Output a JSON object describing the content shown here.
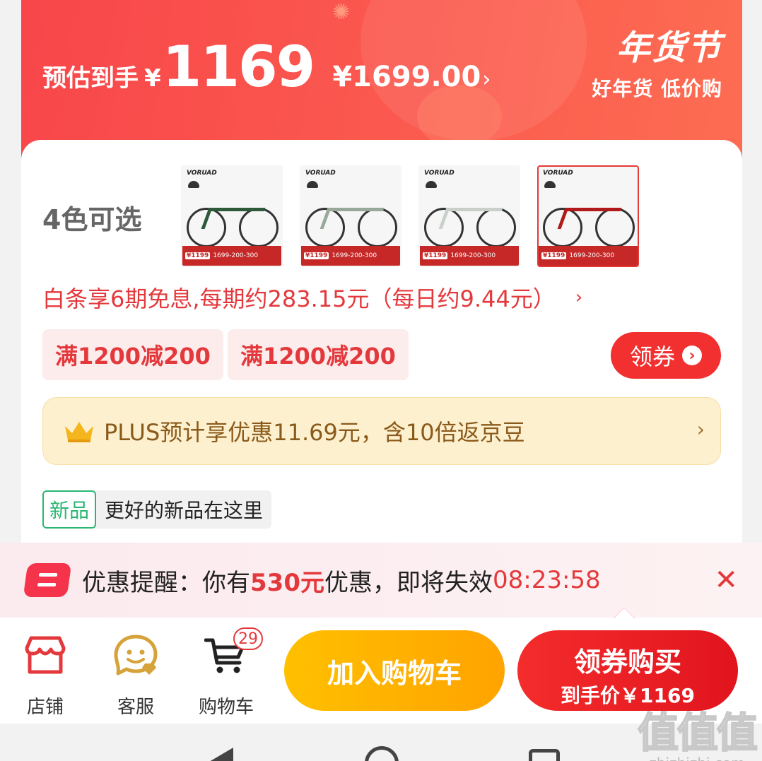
{
  "banner": {
    "estimate_label": "预估到手",
    "yen": "¥",
    "price": "1169",
    "original_price": "¥1699.00",
    "chevron": "›",
    "festival_title": "年货节",
    "festival_sub": "好年货 低价购"
  },
  "product": {
    "color_label": "4色可选",
    "variants": [
      {
        "brand": "VORUAD",
        "frame_color": "#2f5a3a",
        "price_badge": "¥1199",
        "strip_text": "1699-200-300",
        "selected": false
      },
      {
        "brand": "VORUAD",
        "frame_color": "#9aa89a",
        "price_badge": "¥1199",
        "strip_text": "1699-200-300",
        "selected": false
      },
      {
        "brand": "VORUAD",
        "frame_color": "#c9cfc9",
        "price_badge": "¥1199",
        "strip_text": "1699-200-300",
        "selected": false
      },
      {
        "brand": "VORUAD",
        "frame_color": "#b01a1a",
        "price_badge": "¥1199",
        "strip_text": "1699-200-300",
        "selected": true
      }
    ]
  },
  "installment": {
    "text": "白条享6期免息,每期约283.15元（每日约9.44元）",
    "chevron": "›"
  },
  "coupons": {
    "tags": [
      "满1200减200",
      "满1200减200"
    ],
    "claim_label": "领券",
    "claim_arrow": "›"
  },
  "plus": {
    "text": "PLUS预计享优惠11.69元，含10倍返京豆",
    "chevron": "›"
  },
  "new_product": {
    "tag": "新品",
    "text": "更好的新品在这里"
  },
  "reminder": {
    "prefix": "优惠提醒：你有",
    "amount": "530元",
    "middle": "优惠，即将失效",
    "countdown": "08:23:58",
    "close": "✕"
  },
  "bottom_nav": {
    "items": [
      {
        "label": "店铺",
        "icon": "store-icon"
      },
      {
        "label": "客服",
        "icon": "customer-service-icon"
      },
      {
        "label": "购物车",
        "icon": "cart-icon",
        "badge": "29"
      }
    ],
    "add_to_cart": "加入购物车",
    "buy_title": "领券购买",
    "buy_sub": "到手价￥1169"
  },
  "watermark": {
    "main": "值值值",
    "sub": "zhizhizhi.com"
  },
  "colors": {
    "accent_red": "#e4393c",
    "banner_red": "#f8464a",
    "cart_yellow": "#ffb300",
    "plus_gold": "#8a5a1a",
    "new_green": "#2bb673"
  }
}
